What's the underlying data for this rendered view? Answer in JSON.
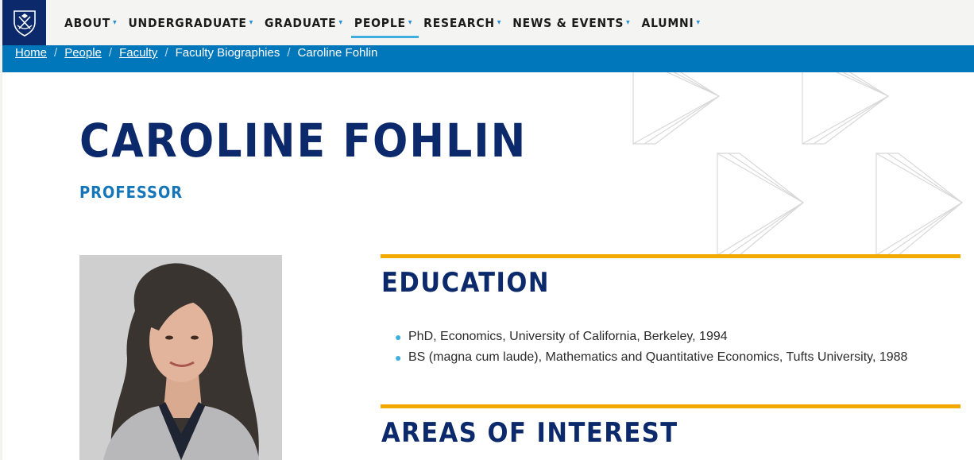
{
  "nav": {
    "items": [
      {
        "label": "ABOUT",
        "active": false
      },
      {
        "label": "UNDERGRADUATE",
        "active": false
      },
      {
        "label": "GRADUATE",
        "active": false
      },
      {
        "label": "PEOPLE",
        "active": true
      },
      {
        "label": "RESEARCH",
        "active": false
      },
      {
        "label": "NEWS & EVENTS",
        "active": false
      },
      {
        "label": "ALUMNI",
        "active": false
      }
    ],
    "logo_icon": "university-shield-icon",
    "caret_icon": "chevron-down-icon"
  },
  "breadcrumb": {
    "home": "Home",
    "people": "People",
    "faculty": "Faculty",
    "faculty_bios": "Faculty Biographies",
    "current": "Caroline Fohlin",
    "separator": "/"
  },
  "profile": {
    "name": "CAROLINE FOHLIN",
    "title": "PROFESSOR",
    "photo_icon": "portrait-photo"
  },
  "education": {
    "heading": "EDUCATION",
    "items": [
      "PhD, Economics, University of California, Berkeley, 1994",
      "BS (magna cum laude), Mathematics and Quantitative Economics, Tufts University, 1988"
    ]
  },
  "interests": {
    "heading": "AREAS OF INTEREST"
  },
  "colors": {
    "navy": "#0c2a6b",
    "blue": "#0077bb",
    "gold": "#f2a900",
    "light_blue": "#3eaede"
  }
}
